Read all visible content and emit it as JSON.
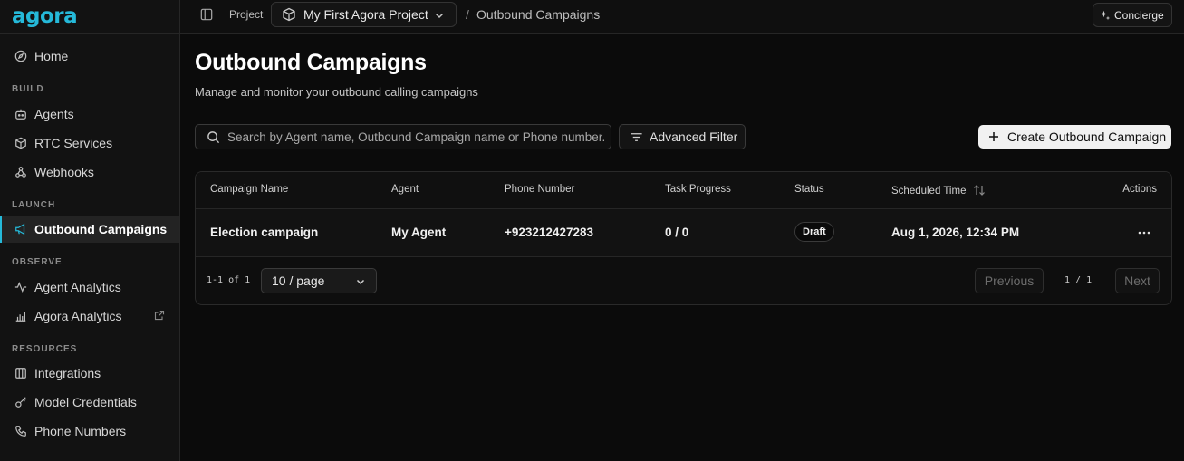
{
  "brand": {
    "logo_text": "agora",
    "accent": "#25b9d9"
  },
  "sidebar": {
    "home": {
      "label": "Home",
      "icon": "compass-icon"
    },
    "sections": {
      "build": "BUILD",
      "launch": "LAUNCH",
      "observe": "OBSERVE",
      "resources": "RESOURCES"
    },
    "items": {
      "agents": {
        "label": "Agents",
        "icon": "bot-icon"
      },
      "rtc": {
        "label": "RTC Services",
        "icon": "cube-icon"
      },
      "webhooks": {
        "label": "Webhooks",
        "icon": "webhook-icon"
      },
      "outbound": {
        "label": "Outbound Campaigns",
        "icon": "megaphone-icon",
        "active": true
      },
      "agent_analytics": {
        "label": "Agent Analytics",
        "icon": "activity-icon"
      },
      "agora_analytics": {
        "label": "Agora Analytics",
        "icon": "bar-chart-icon",
        "external": true
      },
      "integrations": {
        "label": "Integrations",
        "icon": "grid-icon"
      },
      "model_credentials": {
        "label": "Model Credentials",
        "icon": "key-icon"
      },
      "phone_numbers": {
        "label": "Phone Numbers",
        "icon": "phone-icon"
      }
    }
  },
  "topbar": {
    "project_label": "Project",
    "project_name": "My First Agora Project",
    "breadcrumb_separator": "/",
    "breadcrumb_current": "Outbound Campaigns",
    "concierge_label": "Concierge"
  },
  "main": {
    "title": "Outbound Campaigns",
    "subtitle": "Manage and monitor your outbound calling campaigns",
    "search_placeholder": "Search by Agent name, Outbound Campaign name or Phone number.",
    "advanced_filter_label": "Advanced Filter",
    "create_button_label": "Create Outbound Campaign"
  },
  "table": {
    "columns": {
      "campaign_name": "Campaign Name",
      "agent": "Agent",
      "phone_number": "Phone Number",
      "task_progress": "Task Progress",
      "status": "Status",
      "scheduled_time": "Scheduled Time",
      "actions": "Actions"
    },
    "rows": [
      {
        "campaign_name": "Election campaign",
        "agent": "My Agent",
        "phone_number": "+923212427283",
        "task_progress": "0 / 0",
        "status": "Draft",
        "scheduled_time": "Aug 1, 2026, 12:34 PM"
      }
    ],
    "footer": {
      "range_text": "1-1 of 1",
      "page_size": "10 / page",
      "previous_label": "Previous",
      "page_indicator": "1 / 1",
      "next_label": "Next"
    }
  }
}
